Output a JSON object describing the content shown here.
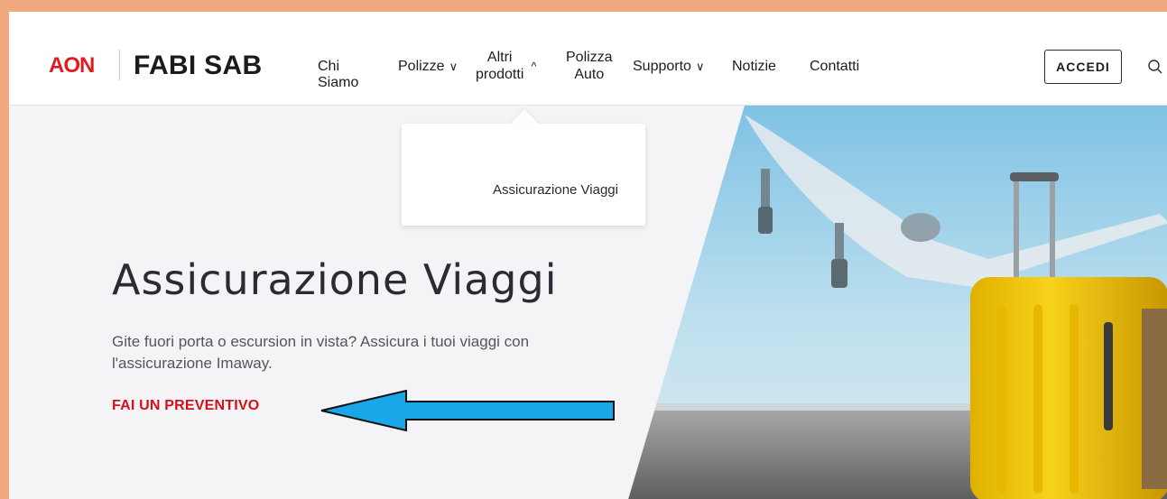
{
  "brand": {
    "aon": "AON",
    "name": "FABI SAB",
    "accent": "#e11b22"
  },
  "nav": {
    "chi_siamo": "Chi Siamo",
    "polizze": "Polizze",
    "altri_line1": "Altri",
    "altri_line2": "prodotti",
    "polizza_line1": "Polizza",
    "polizza_line2": "Auto",
    "supporto": "Supporto",
    "notizie": "Notizie",
    "contatti": "Contatti",
    "chev_down": "∨",
    "chev_up": "^"
  },
  "header": {
    "accedi": "ACCEDI",
    "search_icon": "search-icon"
  },
  "dropdown": {
    "item": "Assicurazione Viaggi"
  },
  "hero": {
    "title": "Assicurazione Viaggi",
    "subtitle": "Gite fuori porta o escursion in vista? Assicura i tuoi viaggi con l'assicurazione Imaway.",
    "cta": "FAI UN PREVENTIVO",
    "cta_color": "#d4101d",
    "annotation_arrow_color": "#1aa7ea"
  }
}
